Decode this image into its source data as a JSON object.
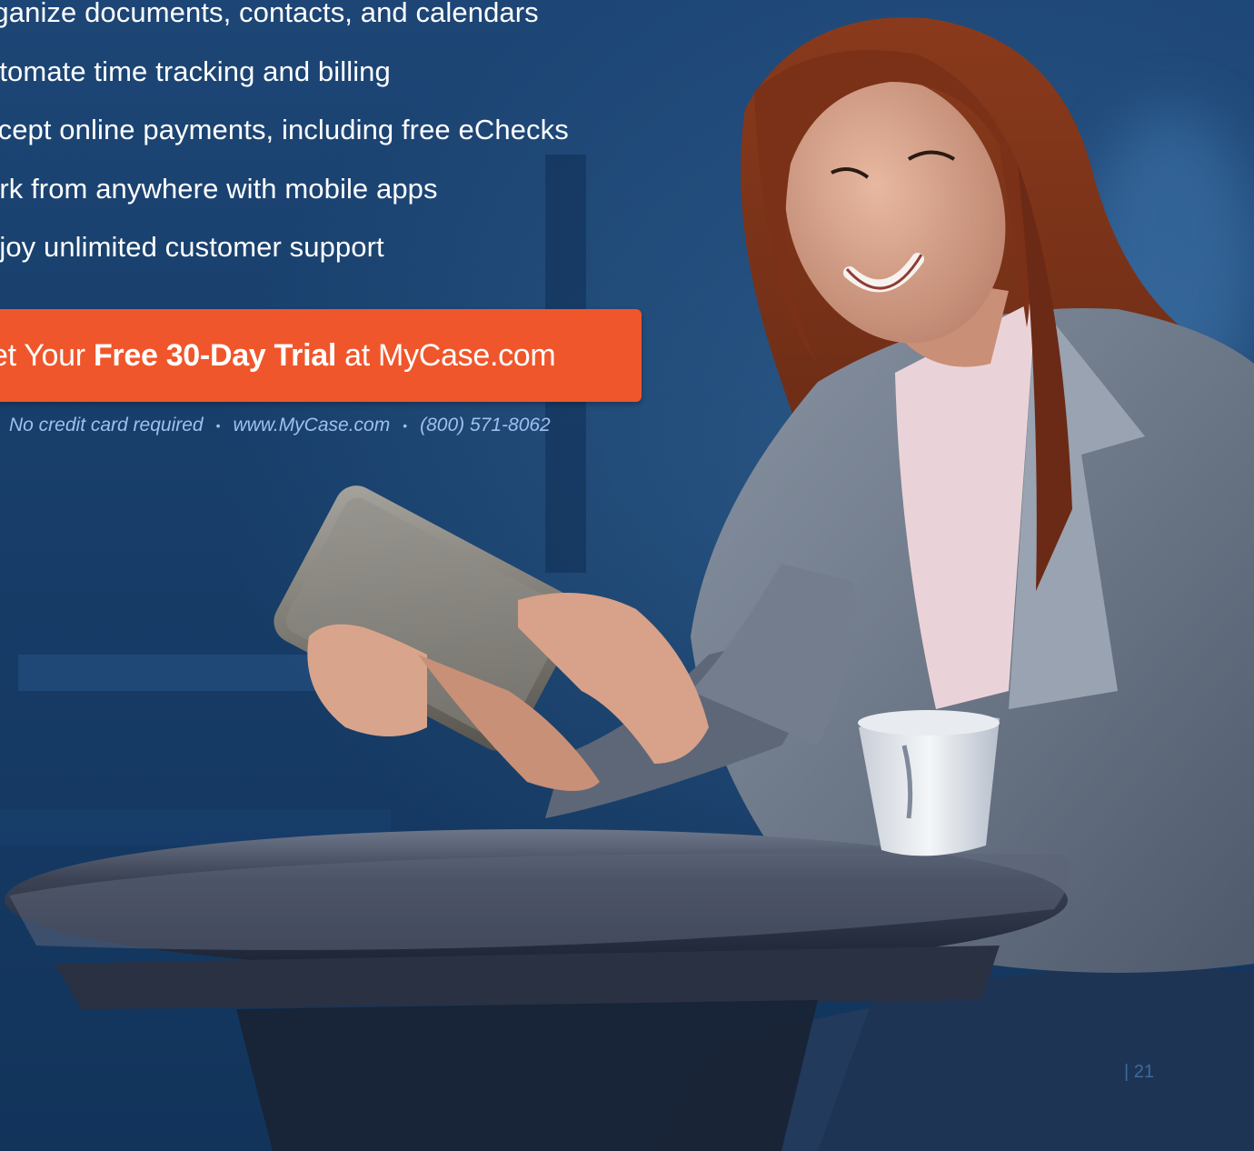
{
  "bullets": [
    "rganize documents, contacts, and calendars",
    "utomate time tracking and billing",
    "ccept online payments, including free eChecks",
    "ork from anywhere with mobile apps",
    "njoy unlimited customer support"
  ],
  "cta": {
    "prefix": "et Your ",
    "bold": "Free 30-Day Trial",
    "suffix": " at MyCase.com"
  },
  "subline": {
    "no_card": "No credit card required",
    "website": "www.MyCase.com",
    "phone": "(800) 571-8062"
  },
  "page_number": "| 21",
  "photo_description_icon": "woman-with-tablet-photo",
  "colors": {
    "background": "#173a63",
    "cta": "#f0562b",
    "subline": "#9ec0f0"
  }
}
